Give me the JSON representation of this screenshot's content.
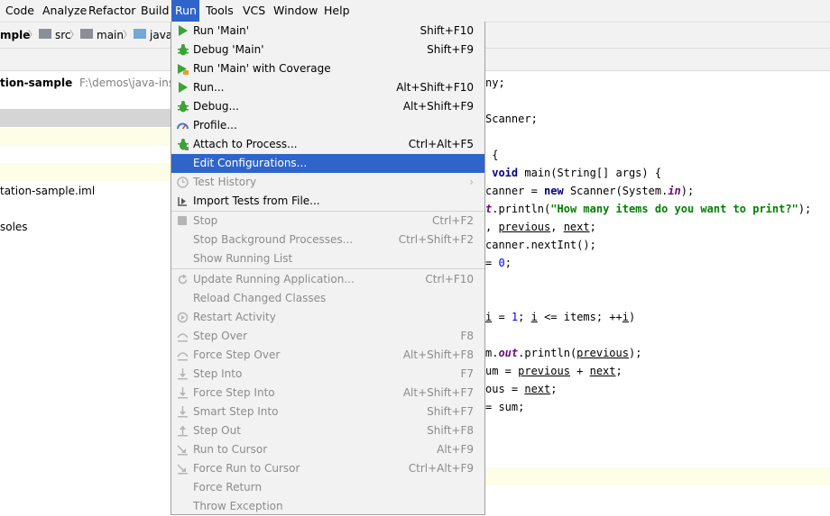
{
  "menubar": {
    "items": [
      "Code",
      "Analyze",
      "Refactor",
      "Build",
      "Run",
      "Tools",
      "VCS",
      "Window",
      "Help"
    ],
    "open_item": "Run"
  },
  "breadcrumb": {
    "project": "mple",
    "src": "src",
    "main": "main",
    "java": "java"
  },
  "project_panel": {
    "root_label": "tion-sample",
    "root_path": "F:\\demos\\java-instrum",
    "iml_file": "tation-sample.iml",
    "consoles": "soles"
  },
  "editor": {
    "lines": [
      {
        "t": "ny;"
      },
      {
        "t": ""
      },
      {
        "t": "Scanner;"
      },
      {
        "t": ""
      },
      {
        "t": " {"
      },
      {
        "t": "void main(String[] args) {"
      },
      {
        "t": "canner = new Scanner(System.in);"
      },
      {
        "t": "t.println(\"How many items do you want to print?\");"
      },
      {
        "t": ", previous, next;"
      },
      {
        "t": "canner.nextInt();"
      },
      {
        "t": "= 0;"
      },
      {
        "t": ""
      },
      {
        "t": ""
      },
      {
        "t": "i = 1; i <= items; ++i)"
      },
      {
        "t": ""
      },
      {
        "t": "m.out.println(previous);"
      },
      {
        "t": "um = previous + next;"
      },
      {
        "t": "ous = next;"
      },
      {
        "t": "= sum;"
      }
    ]
  },
  "run_menu": {
    "items": [
      {
        "label": "Run 'Main'",
        "shortcut": "Shift+F10",
        "icon": "run-icon",
        "state": "enabled"
      },
      {
        "label": "Debug 'Main'",
        "shortcut": "Shift+F9",
        "icon": "debug-icon",
        "state": "enabled"
      },
      {
        "label": "Run 'Main' with Coverage",
        "shortcut": "",
        "icon": "coverage-icon",
        "state": "enabled"
      },
      {
        "label": "Run...",
        "shortcut": "Alt+Shift+F10",
        "icon": "run-icon",
        "state": "enabled"
      },
      {
        "label": "Debug...",
        "shortcut": "Alt+Shift+F9",
        "icon": "debug-icon",
        "state": "enabled"
      },
      {
        "label": "Profile...",
        "shortcut": "",
        "icon": "profile-icon",
        "state": "enabled"
      },
      {
        "label": "Attach to Process...",
        "shortcut": "Ctrl+Alt+F5",
        "icon": "attach-icon",
        "state": "enabled"
      },
      {
        "label": "Edit Configurations...",
        "shortcut": "",
        "icon": "",
        "state": "selected"
      },
      {
        "label": "Test History",
        "shortcut": "",
        "icon": "clock-icon",
        "state": "disabled"
      },
      {
        "label": "Import Tests from File...",
        "shortcut": "",
        "icon": "import-icon",
        "state": "enabled"
      },
      {
        "label": "Stop",
        "shortcut": "Ctrl+F2",
        "icon": "stop-icon",
        "state": "disabled"
      },
      {
        "label": "Stop Background Processes...",
        "shortcut": "Ctrl+Shift+F2",
        "icon": "",
        "state": "disabled"
      },
      {
        "label": "Show Running List",
        "shortcut": "",
        "icon": "",
        "state": "disabled"
      },
      {
        "label": "Update Running Application...",
        "shortcut": "Ctrl+F10",
        "icon": "update-icon",
        "state": "disabled"
      },
      {
        "label": "Reload Changed Classes",
        "shortcut": "",
        "icon": "",
        "state": "disabled"
      },
      {
        "label": "Restart Activity",
        "shortcut": "",
        "icon": "restart-icon",
        "state": "disabled"
      },
      {
        "label": "Step Over",
        "shortcut": "F8",
        "icon": "step-over-icon",
        "state": "disabled"
      },
      {
        "label": "Force Step Over",
        "shortcut": "Alt+Shift+F8",
        "icon": "force-step-over-icon",
        "state": "disabled"
      },
      {
        "label": "Step Into",
        "shortcut": "F7",
        "icon": "step-into-icon",
        "state": "disabled"
      },
      {
        "label": "Force Step Into",
        "shortcut": "Alt+Shift+F7",
        "icon": "force-step-into-icon",
        "state": "disabled"
      },
      {
        "label": "Smart Step Into",
        "shortcut": "Shift+F7",
        "icon": "smart-step-into-icon",
        "state": "disabled"
      },
      {
        "label": "Step Out",
        "shortcut": "Shift+F8",
        "icon": "step-out-icon",
        "state": "disabled"
      },
      {
        "label": "Run to Cursor",
        "shortcut": "Alt+F9",
        "icon": "run-to-cursor-icon",
        "state": "disabled"
      },
      {
        "label": "Force Run to Cursor",
        "shortcut": "Ctrl+Alt+F9",
        "icon": "force-run-to-cursor-icon",
        "state": "disabled"
      },
      {
        "label": "Force Return",
        "shortcut": "",
        "icon": "",
        "state": "disabled"
      },
      {
        "label": "Throw Exception",
        "shortcut": "",
        "icon": "",
        "state": "disabled"
      }
    ],
    "submenu_arrow": "›"
  },
  "colors": {
    "selection": "#2f65ca",
    "menu_bg": "#f2f2f2",
    "disabled_text": "#8c8c8c",
    "run_green": "#3aa335",
    "line_highlight": "#fdfde8"
  }
}
